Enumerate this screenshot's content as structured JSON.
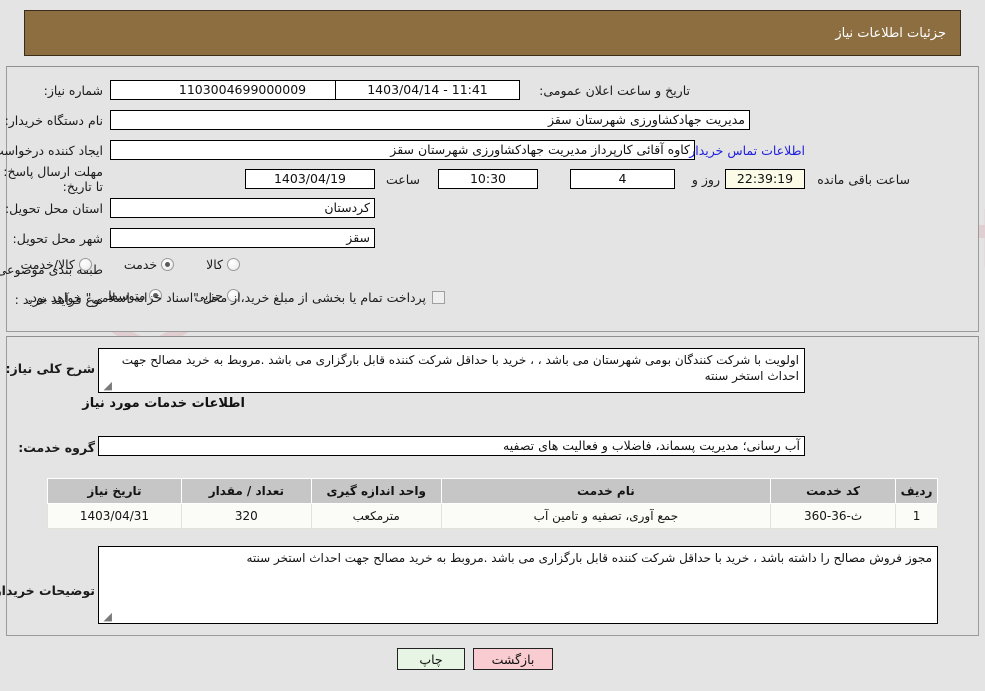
{
  "header": {
    "title": "جزئیات اطلاعات نیاز",
    "bar_color": "#8d6e41"
  },
  "watermark": {
    "text": "AriaTender.net"
  },
  "request_info": {
    "need_number_label": "شماره نیاز:",
    "need_number_value": "1103004699000009",
    "announce_datetime_label": "تاریخ و ساعت اعلان عمومی:",
    "announce_datetime_value": "1403/04/14 - 11:41",
    "buyer_org_label": "نام دستگاه خریدار:",
    "buyer_org_value": "مدیریت جهادکشاورزی شهرستان سقز",
    "creator_label": "ایجاد کننده درخواست:",
    "creator_value": "کاوه آقائی کارپرداز مدیریت جهادکشاورزی شهرستان سقز",
    "contact_link": "اطلاعات تماس خریدار",
    "deadline_label": "مهلت ارسال پاسخ: تا تاریخ:",
    "deadline_date": "1403/04/19",
    "deadline_hour_label": "ساعت",
    "deadline_hour_value": "10:30",
    "days_remaining": "4",
    "days_label": "روز و",
    "countdown_value": "22:39:19",
    "countdown_label": "ساعت باقی مانده",
    "province_label": "استان محل تحویل:",
    "province_value": "کردستان",
    "city_label": "شهر محل تحویل:",
    "city_value": "سقز",
    "category_label": "طبقه بندی موضوعی:",
    "category_options": [
      {
        "label": "کالا",
        "selected": false
      },
      {
        "label": "خدمت",
        "selected": true
      },
      {
        "label": "کالا/خدمت",
        "selected": false
      }
    ],
    "process_label": "نوع فرآیند خرید :",
    "process_options": [
      {
        "label": "جزیی",
        "selected": false
      },
      {
        "label": "متوسط",
        "selected": true
      }
    ],
    "treasury_checkbox_label": "پرداخت تمام یا بخشی از مبلغ خرید،از محل \"اسناد خزانه اسلامی\" خواهد بود.",
    "treasury_checked": false
  },
  "need_description": {
    "label": "شرح کلی نیاز:",
    "value": "اولویت با شرکت کنندگان بومی شهرستان می باشد ، ، خرید با حداقل شرکت کننده قابل بارگزاری می باشد .مروبط به خرید مصالح جهت احداث استخر سنته"
  },
  "services_section": {
    "heading": "اطلاعات خدمات مورد نیاز",
    "service_group_label": "گروه خدمت:",
    "service_group_value": "آب رسانی؛ مدیریت پسماند، فاضلاب و فعالیت های تصفیه"
  },
  "table": {
    "columns": [
      "ردیف",
      "کد خدمت",
      "نام خدمت",
      "واحد اندازه گیری",
      "تعداد / مقدار",
      "تاریخ نیاز"
    ],
    "rows": [
      {
        "row": "1",
        "code": "ث-36-360",
        "name": "جمع آوری، تصفیه و تامین آب",
        "unit": "مترمکعب",
        "quantity": "320",
        "date": "1403/04/31"
      }
    ]
  },
  "buyer_notes": {
    "label": "توضیحات خریدار:",
    "value": "مجوز فروش مصالح را داشته باشد ، خرید با حداقل شرکت کننده قابل بارگزاری می باشد .مروبط به خرید مصالح جهت احداث استخر سنته"
  },
  "footer": {
    "back_label": "بازگشت",
    "print_label": "چاپ"
  }
}
